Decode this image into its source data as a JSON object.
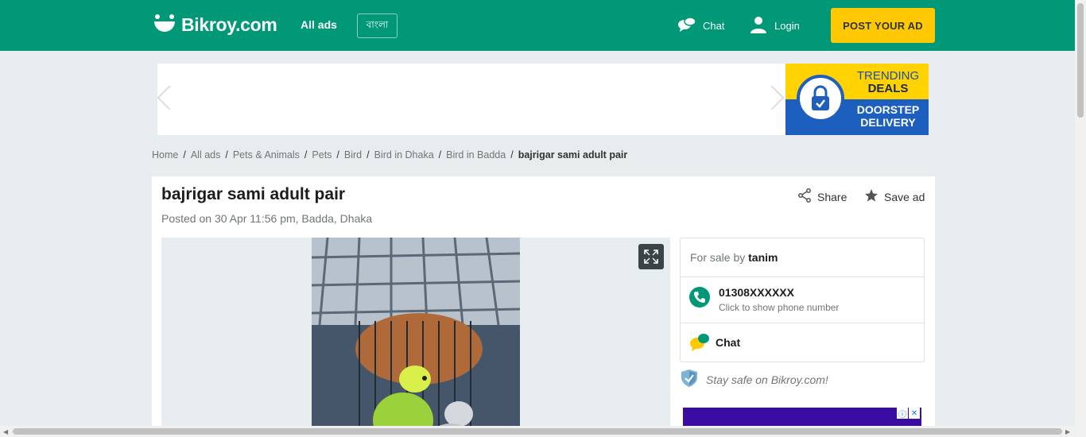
{
  "header": {
    "logo_text": "Bikroy.com",
    "all_ads": "All ads",
    "language": "বাংলা",
    "chat": "Chat",
    "login": "Login",
    "post_ad": "POST YOUR AD",
    "bg_color": "#009877",
    "cta_color": "#ffc800"
  },
  "banner": {
    "line1": "TRENDING",
    "line2": "DEALS",
    "line3": "DOORSTEP",
    "line4": "DELIVERY"
  },
  "breadcrumb": [
    "Home",
    "All ads",
    "Pets & Animals",
    "Pets",
    "Bird",
    "Bird in Dhaka",
    "Bird in Badda",
    "bajrigar sami adult pair"
  ],
  "ad": {
    "title": "bajrigar sami adult pair",
    "posted": "Posted on 30 Apr 11:56 pm, Badda, Dhaka",
    "share": "Share",
    "save": "Save ad"
  },
  "seller": {
    "for_sale_by": "For sale by",
    "name": "tanim",
    "phone": "01308XXXXXX",
    "phone_hint": "Click to show phone number",
    "chat": "Chat"
  },
  "safety": "Stay safe on Bikroy.com!"
}
